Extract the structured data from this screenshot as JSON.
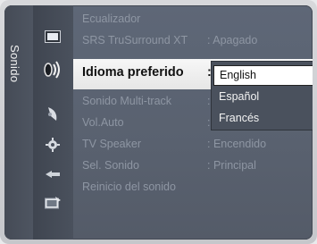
{
  "menu": {
    "section_title": "Sonido",
    "items": [
      {
        "label": "Ecualizador",
        "value": ""
      },
      {
        "label": "SRS TruSurround XT",
        "value": ": Apagado"
      },
      {
        "label": "Idioma preferido",
        "value": ":"
      },
      {
        "label": "Sonido Multi-track",
        "value": ":"
      },
      {
        "label": "Vol.Auto",
        "value": ":"
      },
      {
        "label": "TV Speaker",
        "value": ": Encendido"
      },
      {
        "label": "Sel. Sonido",
        "value": ": Principal"
      },
      {
        "label": "Reinicio del sonido",
        "value": ""
      }
    ]
  },
  "dropdown": {
    "options": [
      "English",
      "Español",
      "Francés"
    ],
    "selected": "English"
  },
  "icons": [
    "picture-icon",
    "sound-icon",
    "channel-icon",
    "setup-icon",
    "input-icon",
    "application-icon"
  ]
}
